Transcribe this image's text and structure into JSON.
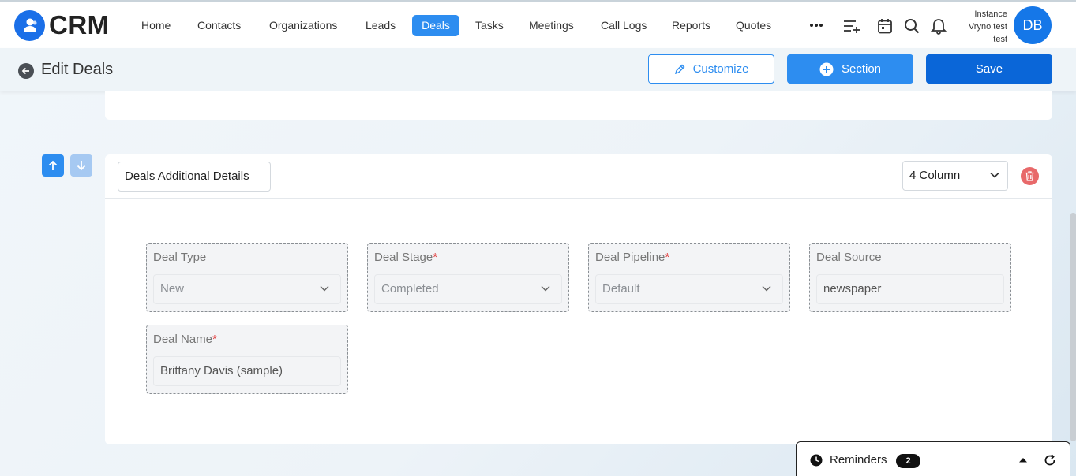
{
  "app": {
    "name": "CRM"
  },
  "nav": {
    "items": [
      {
        "label": "Home"
      },
      {
        "label": "Contacts"
      },
      {
        "label": "Organizations"
      },
      {
        "label": "Leads"
      },
      {
        "label": "Deals"
      },
      {
        "label": "Tasks"
      },
      {
        "label": "Meetings"
      },
      {
        "label": "Call Logs"
      },
      {
        "label": "Reports"
      },
      {
        "label": "Quotes"
      }
    ],
    "active": "Deals"
  },
  "user": {
    "instance_line1": "Instance",
    "instance_line2": "Vryno test",
    "instance_line3": "test",
    "initials": "DB"
  },
  "header": {
    "title": "Edit Deals",
    "customize_label": "Customize",
    "section_label": "Section",
    "save_label": "Save"
  },
  "section": {
    "name": "Deals Additional Details",
    "columns": "4 Column",
    "fields": [
      {
        "label": "Deal Type",
        "required": "",
        "value": "New"
      },
      {
        "label": "Deal Stage",
        "required": "*",
        "value": "Completed"
      },
      {
        "label": "Deal Pipeline",
        "required": "*",
        "value": "Default"
      },
      {
        "label": "Deal Source",
        "required": "",
        "value": "newspaper"
      },
      {
        "label": "Deal Name",
        "required": "*",
        "value": "Brittany Davis (sample)"
      }
    ]
  },
  "reminders": {
    "label": "Reminders",
    "count": "2"
  },
  "colors": {
    "primary": "#2d8df0",
    "save": "#0a66d8",
    "danger": "#e8696a"
  }
}
